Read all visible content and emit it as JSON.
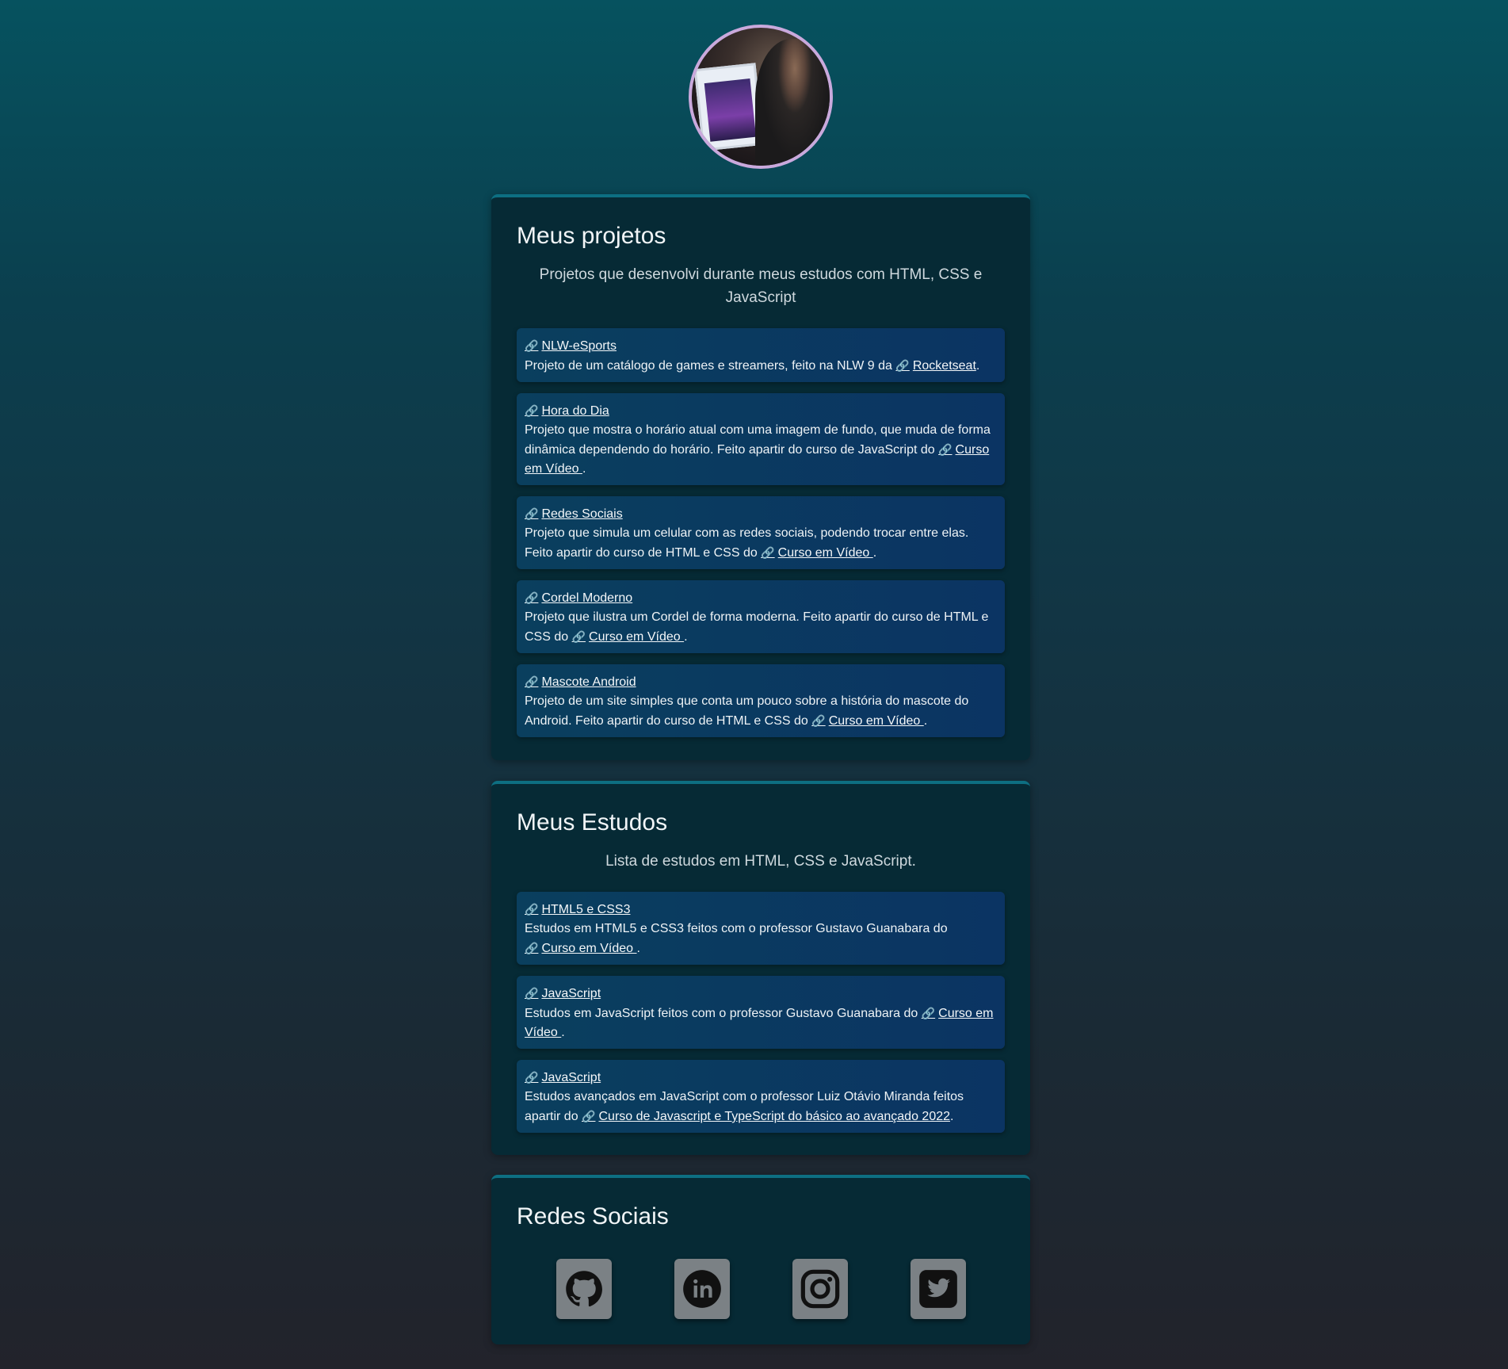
{
  "avatar": {
    "icon": "profile-photo"
  },
  "projects": {
    "title": "Meus projetos",
    "subtitle": "Projetos que desenvolvi durante meus estudos com HTML, CSS e JavaScript",
    "link_icon": "🔗",
    "items": [
      {
        "name": "NLW-eSports",
        "desc": "Projeto de um catálogo de games e streamers, feito na NLW 9 da",
        "source": "Rocketseat",
        "end": "."
      },
      {
        "name": "Hora do Dia",
        "desc": "Projeto que mostra o horário atual com uma imagem de fundo, que muda de forma dinâmica dependendo do horário. Feito apartir do curso de JavaScript do",
        "source": "Curso em Vídeo ",
        "end": "."
      },
      {
        "name": "Redes Sociais",
        "desc": "Projeto que simula um celular com as redes sociais, podendo trocar entre elas. Feito apartir do curso de HTML e CSS do",
        "source": "Curso em Vídeo ",
        "end": "."
      },
      {
        "name": "Cordel Moderno",
        "desc": "Projeto que ilustra um Cordel de forma moderna. Feito apartir do curso de HTML e CSS do",
        "source": "Curso em Vídeo ",
        "end": "."
      },
      {
        "name": "Mascote Android",
        "desc": "Projeto de um site simples que conta um pouco sobre a história do mascote do Android. Feito apartir do curso de HTML e CSS do",
        "source": "Curso em Vídeo ",
        "end": "."
      }
    ]
  },
  "studies": {
    "title": "Meus Estudos",
    "subtitle": "Lista de estudos em HTML, CSS e JavaScript.",
    "items": [
      {
        "name": "HTML5 e CSS3",
        "desc": "Estudos em HTML5 e CSS3 feitos com o professor Gustavo Guanabara do",
        "source": "Curso em Vídeo ",
        "end": "."
      },
      {
        "name": "JavaScript",
        "desc": "Estudos em JavaScript feitos com o professor Gustavo Guanabara do",
        "source": "Curso em Vídeo ",
        "end": "."
      },
      {
        "name": "JavaScript",
        "desc": "Estudos avançados em JavaScript com o professor Luiz Otávio Miranda feitos apartir do",
        "source": "Curso de Javascript e TypeScript do básico ao avançado 2022",
        "end": "."
      }
    ]
  },
  "social": {
    "title": "Redes Sociais",
    "links": [
      {
        "icon": "github-icon"
      },
      {
        "icon": "linkedin-icon"
      },
      {
        "icon": "instagram-icon"
      },
      {
        "icon": "twitter-icon"
      }
    ]
  }
}
